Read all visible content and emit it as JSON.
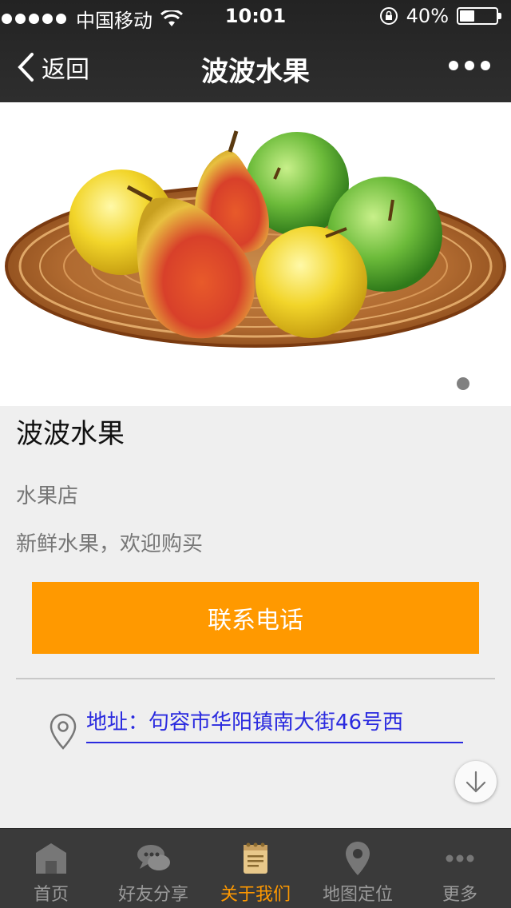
{
  "status_bar": {
    "carrier": "中国移动",
    "time": "10:01",
    "battery_percent_text": "40%",
    "battery_level": 0.4
  },
  "nav": {
    "back_label": "返回",
    "title": "波波水果"
  },
  "banner": {
    "slide_count": 2,
    "active_slide": 0
  },
  "store": {
    "name": "波波水果",
    "category": "水果店",
    "description": "新鲜水果，欢迎购买",
    "call_button_label": "联系电话",
    "address": "地址：句容市华阳镇南大街46号西"
  },
  "tabbar": {
    "items": [
      {
        "label": "首页",
        "icon": "home-icon"
      },
      {
        "label": "好友分享",
        "icon": "chat-bubbles-icon"
      },
      {
        "label": "关于我们",
        "icon": "notepad-icon"
      },
      {
        "label": "地图定位",
        "icon": "map-pin-icon"
      },
      {
        "label": "更多",
        "icon": "more-dots-icon"
      }
    ],
    "active_index": 2
  },
  "colors": {
    "accent": "#ff9900",
    "link": "#2a2adf",
    "nav_background": "#2b2b2b",
    "tabbar_background": "#3a3a3a"
  }
}
